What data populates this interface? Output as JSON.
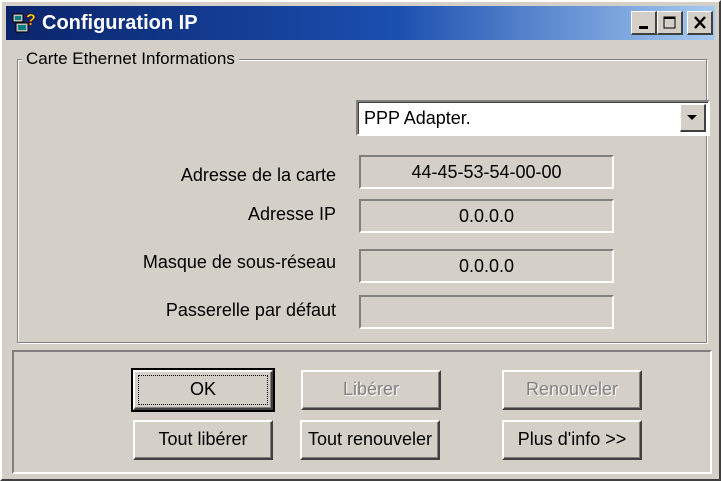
{
  "window": {
    "title": "Configuration IP",
    "controls": [
      "minimize-icon",
      "maximize-icon",
      "close-icon"
    ],
    "title_gradient": [
      "#0a246a",
      "#a6caf0"
    ],
    "face_color": "#d4d0c8"
  },
  "group": {
    "legend": "Carte Ethernet  Informations",
    "adapter_select": {
      "value": "PPP Adapter."
    },
    "fields": [
      {
        "label": "Adresse de la carte",
        "value": "44-45-53-54-00-00"
      },
      {
        "label": "Adresse IP",
        "value": "0.0.0.0"
      },
      {
        "label": "Masque de sous-réseau",
        "value": "0.0.0.0"
      },
      {
        "label": "Passerelle par défaut",
        "value": ""
      }
    ]
  },
  "buttons": {
    "ok": "OK",
    "liberer": "Libérer",
    "renouveler": "Renouveler",
    "tout_liberer": "Tout libérer",
    "tout_renouveler": "Tout renouveler",
    "plus_info": "Plus d'info >>"
  }
}
